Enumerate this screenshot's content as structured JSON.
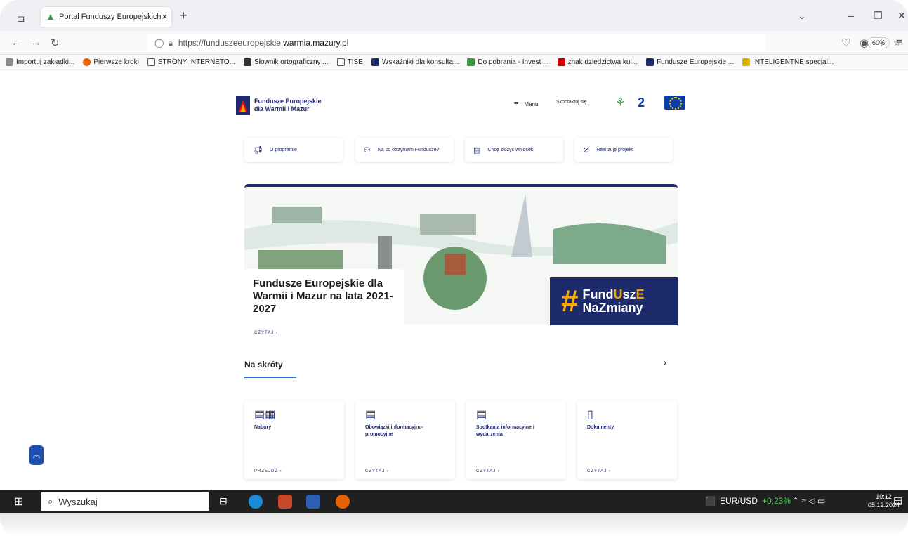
{
  "browser": {
    "tab_title": "Portal Funduszy Europejskich -  ",
    "new_tab": "+",
    "tab_close": "×",
    "url_prefix": "https://funduszeeuropejskie.",
    "url_host": "warmia.mazury.pl",
    "zoom": "60%",
    "bookmarks": [
      {
        "label": "Importuj zakładki...",
        "color": "#888888"
      },
      {
        "label": "Pierwsze kroki",
        "color": "#e66000"
      },
      {
        "label": "STRONY INTERNETO...",
        "color": "#888888"
      },
      {
        "label": "Słownik ortograficzny ...",
        "color": "#333333"
      },
      {
        "label": "TISE",
        "color": "#888888"
      },
      {
        "label": "Wskaźniki dla konsulta...",
        "color": "#1d2a6b"
      },
      {
        "label": "Do pobrania - Invest ...",
        "color": "#3a9a3a"
      },
      {
        "label": "znak dziedzictwa kul...",
        "color": "#cc0000"
      },
      {
        "label": "Fundusze Europejskie ...",
        "color": "#1d2a6b"
      },
      {
        "label": "INTELIGENTNE specjal...",
        "color": "#d8b600"
      }
    ]
  },
  "site": {
    "logo_line1": "Fundusze Europejskie",
    "logo_line2": "dla Warmii i Mazur",
    "menu": "Menu",
    "contact": "Skontaktuj się",
    "quick_links": [
      {
        "label": "O programie",
        "icon": "megaphone-icon"
      },
      {
        "label": "Na co otrzymam Fundusze?",
        "icon": "people-icon"
      },
      {
        "label": "Chcę złożyć wniosek",
        "icon": "document-icon"
      },
      {
        "label": "Realizuję projekt",
        "icon": "check-circle-icon"
      }
    ],
    "hero_title": "Fundusze Europejskie dla Warmii i Mazur na lata 2021-2027",
    "hero_read": "CZYTAJ ›",
    "badge_line1_a": "Fund",
    "badge_line1_b": "U",
    "badge_line1_c": "sz",
    "badge_line1_d": "E",
    "badge_line2": "NaZmiany",
    "section_title": "Na skróty",
    "cards": [
      {
        "title": "Nabory",
        "link": "PRZEJDŹ ›"
      },
      {
        "title": "Obowiązki informacyjno-promocyjne",
        "link": "CZYTAJ ›"
      },
      {
        "title": "Spotkania informacyjne i wydarzenia",
        "link": "CZYTAJ ›"
      },
      {
        "title": "Dokumenty",
        "link": "CZYTAJ ›"
      }
    ]
  },
  "taskbar": {
    "search": "Wyszukaj",
    "fx_pair": "EUR/USD",
    "fx_change": "+0,23%",
    "time": "10:12",
    "date": "05.12.2024"
  },
  "colors": {
    "brand": "#1d2a6b",
    "accent": "#f7a800",
    "positive": "#4fd35a"
  }
}
